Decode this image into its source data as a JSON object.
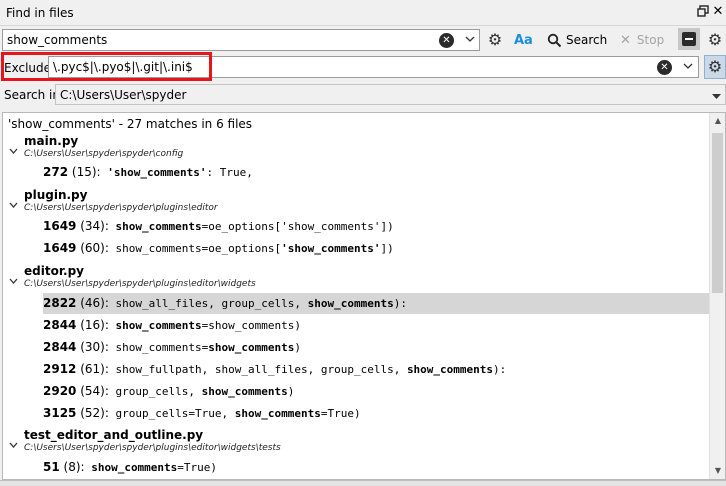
{
  "pane": {
    "title": "Find in files",
    "undock_icon": "undock-icon",
    "close_icon": "close-icon"
  },
  "search": {
    "value": "show_comments",
    "case_label": "Aa",
    "search_label": "Search",
    "stop_label": "Stop"
  },
  "exclude": {
    "label": "Exclude:",
    "value": "\\.pyc$|\\.pyo$|\\.git|\\.ini$"
  },
  "search_in": {
    "label": "Search in:",
    "value": "C:\\Users\\User\\spyder"
  },
  "results": {
    "summary": "'show_comments' - 27 matches in 6 files",
    "files": [
      {
        "name": "main.py",
        "path": "C:\\Users\\User\\spyder\\spyder\\config",
        "matches": [
          {
            "line": "272",
            "col": "(15):",
            "pre": " ",
            "hit": "'show_comments'",
            "post": ": True,"
          }
        ]
      },
      {
        "name": "plugin.py",
        "path": "C:\\Users\\User\\spyder\\spyder\\plugins\\editor",
        "matches": [
          {
            "line": "1649",
            "col": "(34):",
            "pre": " ",
            "hit": "show_comments",
            "post": "=oe_options['show_comments'])"
          },
          {
            "line": "1649",
            "col": "(60):",
            "pre": " show_comments=oe_options[",
            "hit": "'show_comments'",
            "post": "])"
          }
        ]
      },
      {
        "name": "editor.py",
        "path": "C:\\Users\\User\\spyder\\spyder\\plugins\\editor\\widgets",
        "matches": [
          {
            "line": "2822",
            "col": "(46):",
            "pre": " show_all_files, group_cells, ",
            "hit": "show_comments",
            "post": "):"
          },
          {
            "line": "2844",
            "col": "(16):",
            "pre": " ",
            "hit": "show_comments",
            "post": "=show_comments)"
          },
          {
            "line": "2844",
            "col": "(30):",
            "pre": " show_comments=",
            "hit": "show_comments",
            "post": ")"
          },
          {
            "line": "2912",
            "col": "(61):",
            "pre": " show_fullpath, show_all_files, group_cells, ",
            "hit": "show_comments",
            "post": "):"
          },
          {
            "line": "2920",
            "col": "(54):",
            "pre": " group_cells, ",
            "hit": "show_comments",
            "post": ")"
          },
          {
            "line": "3125",
            "col": "(52):",
            "pre": " group_cells=True, ",
            "hit": "show_comments",
            "post": "=True)"
          }
        ]
      },
      {
        "name": "test_editor_and_outline.py",
        "path": "C:\\Users\\User\\spyder\\spyder\\plugins\\editor\\widgets\\tests",
        "matches": [
          {
            "line": "51",
            "col": "(8):",
            "pre": " ",
            "hit": "show_comments",
            "post": "=True)"
          }
        ]
      }
    ]
  },
  "colors": {
    "annotation_red": "#e8141b",
    "case_icon_blue": "#1c8fd9",
    "selected_row": "#d6d6d6"
  }
}
